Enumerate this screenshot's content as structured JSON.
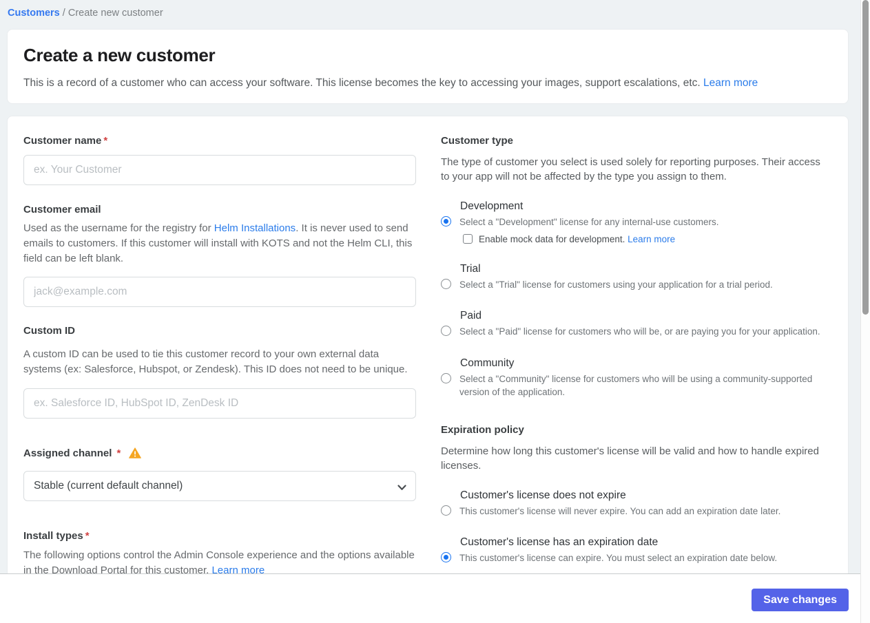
{
  "breadcrumb": {
    "link": "Customers",
    "separator": " / ",
    "current": "Create new customer"
  },
  "header": {
    "title": "Create a new customer",
    "description": "This is a record of a customer who can access your software. This license becomes the key to accessing your images, support escalations, etc. ",
    "learn_more": "Learn more"
  },
  "form": {
    "customer_name": {
      "label": "Customer name",
      "required": "*",
      "placeholder": "ex. Your Customer"
    },
    "customer_email": {
      "label": "Customer email",
      "description_before_link": "Used as the username for the registry for ",
      "link": "Helm Installations",
      "description_after_link": ". It is never used to send emails to customers. If this customer will install with KOTS and not the Helm CLI, this field can be left blank.",
      "placeholder": "jack@example.com"
    },
    "custom_id": {
      "label": "Custom ID",
      "description": "A custom ID can be used to tie this customer record to your own external data systems (ex: Salesforce, Hubspot, or Zendesk). This ID does not need to be unique.",
      "placeholder": "ex. Salesforce ID, HubSpot ID, ZenDesk ID"
    },
    "assigned_channel": {
      "label": "Assigned channel",
      "required": "*",
      "selected_option": "Stable (current default channel)"
    },
    "install_types": {
      "label": "Install types",
      "required": "*",
      "description": "The following options control the Admin Console experience and the options available in the Download Portal for this customer. ",
      "learn_more": "Learn more"
    }
  },
  "customer_type": {
    "heading": "Customer type",
    "description": "The type of customer you select is used solely for reporting purposes. Their access to your app will not be affected by the type you assign to them.",
    "options": [
      {
        "label": "Development",
        "description": "Select a \"Development\" license for any internal-use customers.",
        "selected": true,
        "checkbox": {
          "label": "Enable mock data for development. ",
          "learn_more": "Learn more",
          "checked": false
        }
      },
      {
        "label": "Trial",
        "description": "Select a \"Trial\" license for customers using your application for a trial period.",
        "selected": false
      },
      {
        "label": "Paid",
        "description": "Select a \"Paid\" license for customers who will be, or are paying you for your application.",
        "selected": false
      },
      {
        "label": "Community",
        "description": "Select a \"Community\" license for customers who will be using a community-supported version of the application.",
        "selected": false
      }
    ]
  },
  "expiration_policy": {
    "heading": "Expiration policy",
    "description": "Determine how long this customer's license will be valid and how to handle expired licenses.",
    "options": [
      {
        "label": "Customer's license does not expire",
        "description": "This customer's license will never expire. You can add an expiration date later.",
        "selected": false
      },
      {
        "label": "Customer's license has an expiration date",
        "description": "This customer's license can expire. You must select an expiration date below.",
        "selected": true
      }
    ]
  },
  "footer": {
    "save_button": "Save changes"
  },
  "colors": {
    "accent_blue_link": "#2b7cea",
    "radio_selected": "#1873f0",
    "save_button": "#5463e8",
    "warning_orange": "#f5a623",
    "required_red": "#d14242",
    "page_background": "#eef2f4"
  }
}
